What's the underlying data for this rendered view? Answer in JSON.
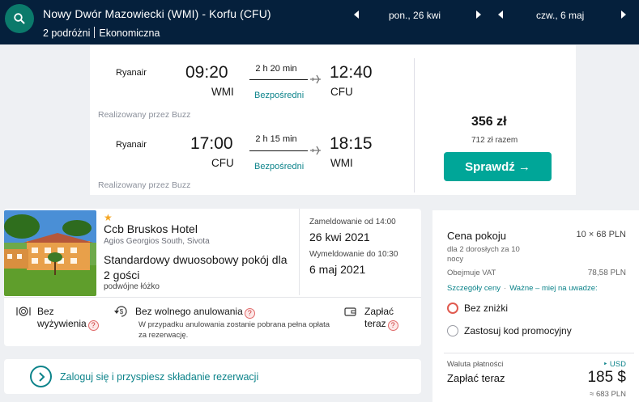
{
  "header": {
    "route": "Nowy Dwór Mazowiecki (WMI) - Korfu (CFU)",
    "travellers": "2 podróżni",
    "cabin": "Ekonomiczna",
    "depart_date": "pon., 26 kwi",
    "return_date": "czw., 6 maj",
    "bg_color": "#05203c"
  },
  "flight": {
    "outbound": {
      "airline": "Ryanair",
      "dep_time": "09:20",
      "dep_code": "WMI",
      "duration": "2 h 20 min",
      "stops": "Bezpośredni",
      "arr_time": "12:40",
      "arr_code": "CFU",
      "operated_by": "Realizowany przez Buzz"
    },
    "inbound": {
      "airline": "Ryanair",
      "dep_time": "17:00",
      "dep_code": "CFU",
      "duration": "2 h 15 min",
      "stops": "Bezpośredni",
      "arr_time": "18:15",
      "arr_code": "WMI",
      "operated_by": "Realizowany przez Buzz"
    },
    "price": "356 zł",
    "total": "712 zł razem",
    "cta": "Sprawdź →",
    "accent": "#00a698"
  },
  "hotel": {
    "stars": "★",
    "name": "Ccb Bruskos Hotel",
    "location": "Agios Georgios South, Sivota",
    "room": "Standardowy dwuosobowy pokój dla 2 gości",
    "bed": "podwójne łóżko",
    "checkin_label": "Zameldowanie od 14:00",
    "checkin_date": "26 kwi 2021",
    "checkout_label": "Wymeldowanie do 10:30",
    "checkout_date": "6 maj 2021",
    "amenities": {
      "meals_line1": "Bez",
      "meals_line2": "wyżywienia",
      "cancel": "Bez wolnego anulowania",
      "cancel_note": "W przypadku anulowania zostanie pobrana pełna opłata za rezerwację.",
      "pay_line1": "Zapłać",
      "pay_line2": "teraz",
      "help": "?"
    }
  },
  "login": {
    "text": "Zaloguj się i przyspiesz składanie rezerwacji"
  },
  "price_panel": {
    "title": "Cena pokoju",
    "multiplier": "10 × 68 PLN",
    "guests_line1": "dla 2 dorosłych  za 10",
    "guests_line2": "nocy",
    "vat_label": "Obejmuje VAT",
    "vat_value": "78,58 PLN",
    "link_details": "Szczegóły ceny",
    "link_important": "Ważne – miej na uwadze:",
    "option_no_discount": "Bez zniżki",
    "option_promo": "Zastosuj kod promocyjny",
    "currency_label": "Waluta płatności",
    "currency_value": "‣ USD",
    "pay_now": "Zapłać teraz",
    "amount": "185 $",
    "approx": "≈ 683 PLN"
  }
}
